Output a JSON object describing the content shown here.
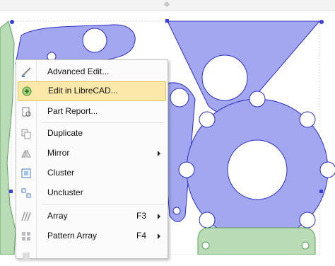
{
  "colors": {
    "part_fill": "#a3a7ef",
    "part_stroke": "#2b2fc0",
    "green_fill": "#b9dcb7",
    "green_stroke": "#5aa35a",
    "highlight": "#fce8a8"
  },
  "top_handle_icon": "diamond-handle-icon",
  "menu": {
    "items": [
      {
        "id": "advanced-edit",
        "icon": "pencil-ruler-icon",
        "label": "Advanced Edit..."
      },
      {
        "id": "edit-in-librecad",
        "icon": "librecad-icon",
        "label": "Edit in LibreCAD...",
        "highlighted": true
      },
      {
        "id": "part-report",
        "icon": "report-icon",
        "label": "Part Report..."
      },
      {
        "id": "duplicate",
        "icon": "duplicate-icon",
        "label": "Duplicate"
      },
      {
        "id": "mirror",
        "icon": "mirror-icon",
        "label": "Mirror",
        "submenu": true
      },
      {
        "id": "cluster",
        "icon": "cluster-icon",
        "label": "Cluster"
      },
      {
        "id": "uncluster",
        "icon": "uncluster-icon",
        "label": "Uncluster"
      },
      {
        "id": "array",
        "icon": "array-icon",
        "label": "Array",
        "shortcut": "F3",
        "submenu": true
      },
      {
        "id": "pattern-array",
        "icon": "pattern-array-icon",
        "label": "Pattern Array",
        "shortcut": "F4",
        "submenu": true
      }
    ]
  }
}
